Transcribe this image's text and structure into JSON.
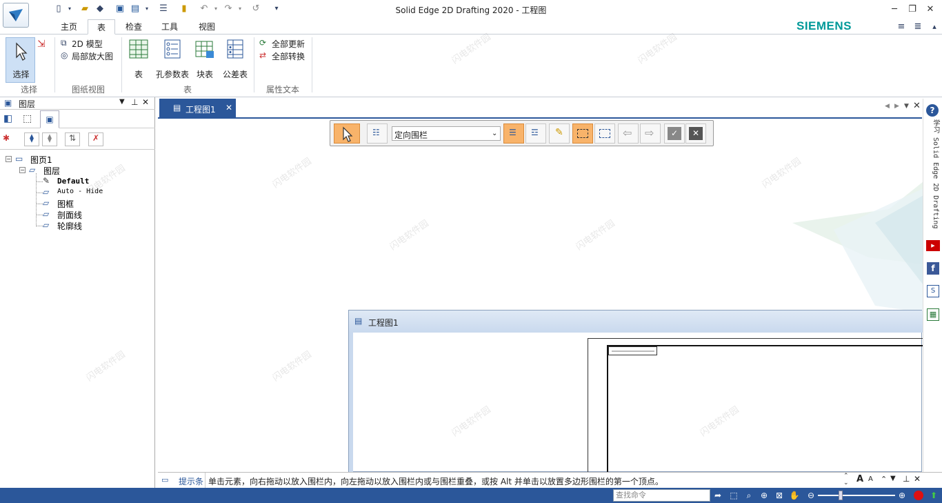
{
  "window": {
    "title": "Solid Edge 2D Drafting 2020 - 工程图"
  },
  "ribbon_tabs": [
    {
      "label": "主页"
    },
    {
      "label": "表"
    },
    {
      "label": "检查"
    },
    {
      "label": "工具"
    },
    {
      "label": "视图"
    }
  ],
  "brand": "SIEMENS",
  "ribbon": {
    "select_label": "选择",
    "select_group": "选择",
    "drawing_views": {
      "model_2d": "2D 模型",
      "detail": "局部放大图",
      "group": "图纸视图"
    },
    "tables": {
      "table": "表",
      "hole_table": "孔参数表",
      "block_table": "块表",
      "tolerance_table": "公差表",
      "group": "表"
    },
    "props": {
      "update_all": "全部更新",
      "convert_all": "全部转换",
      "group": "属性文本"
    }
  },
  "left_panel": {
    "title": "图层",
    "tree": {
      "sheet": "图页1",
      "layers_node": "图层",
      "layers": [
        "Default",
        "Auto - Hide",
        "图框",
        "剖面线",
        "轮廓线"
      ]
    }
  },
  "document_tab": {
    "label": "工程图1"
  },
  "command_bar": {
    "dropdown_value": "定向围栏"
  },
  "inner_window": {
    "title": "工程图1"
  },
  "right_rail": {
    "learn_label": "学习 Solid Edge 2D Drafting"
  },
  "prompt": {
    "label": "提示条",
    "text": "单击元素，向右拖动以放入围栏内，向左拖动以放入围栏内或与围栏重叠，或按 Alt 并单击以放置多边形围栏的第一个顶点。"
  },
  "status": {
    "search_placeholder": "查找命令"
  },
  "watermark": "闪电软件园",
  "colors": {
    "accent": "#2b579a",
    "brand": "#009999",
    "active_button": "#f8b36a"
  }
}
